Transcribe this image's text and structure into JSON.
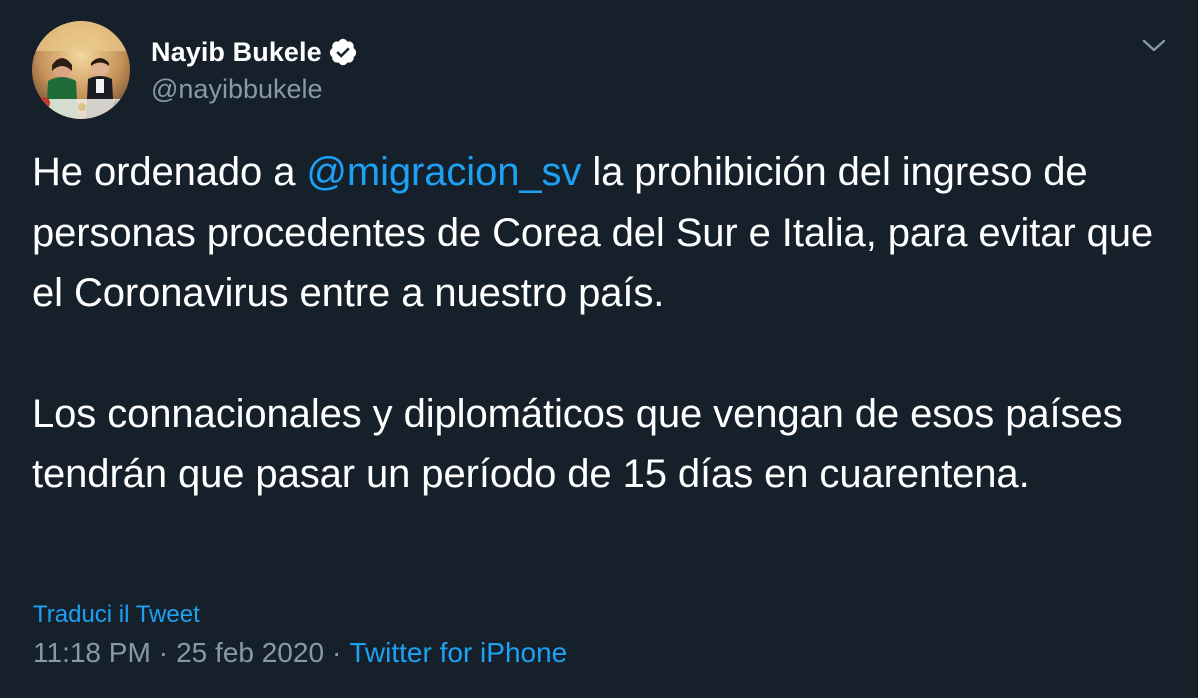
{
  "colors": {
    "background": "#15202b",
    "text": "#ffffff",
    "secondary_text": "#8899a6",
    "accent": "#1da1f2"
  },
  "author": {
    "display_name": "Nayib Bukele",
    "handle": "@nayibbukele",
    "verified": true,
    "verified_icon": "verified-badge-icon",
    "avatar": "profile-photo"
  },
  "menu": {
    "icon": "chevron-down-icon"
  },
  "tweet": {
    "p1_before": "He ordenado a ",
    "mention": "@migracion_sv",
    "p1_after": " la prohibición del ingreso de personas procedentes de Corea del Sur e Italia, para evitar que el Coronavirus entre a nuestro país.",
    "p2": "Los connacionales y diplomáticos que vengan de esos países tendrán que pasar un período de 15 días en cuarentena."
  },
  "translate_label": "Traduci il Tweet",
  "meta": {
    "time": "11:18 PM",
    "separator": "·",
    "date": "25 feb 2020",
    "source": "Twitter for iPhone"
  }
}
